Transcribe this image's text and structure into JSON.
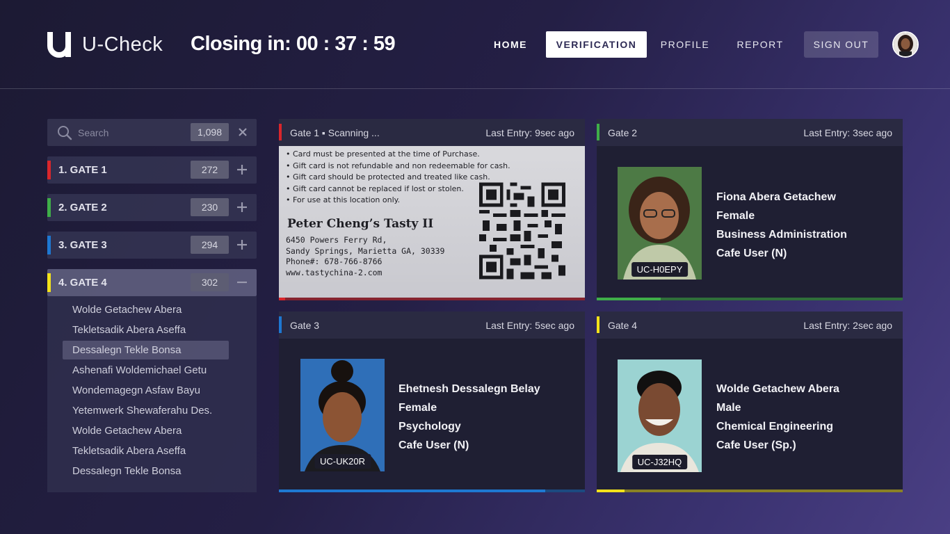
{
  "app": {
    "name": "U-Check",
    "closing": "Closing in: 00 : 37 : 59"
  },
  "nav": {
    "home": "HOME",
    "verification": "VERIFICATION",
    "profile": "PROFILE",
    "report": "REPORT",
    "signout": "SIGN OUT"
  },
  "search": {
    "placeholder": "Search",
    "count": "1,098"
  },
  "gates": [
    {
      "label": "1.  GATE 1",
      "count": "272",
      "color": "#d9262b",
      "toggle": "plus-icon"
    },
    {
      "label": "2.  GATE 2",
      "count": "230",
      "color": "#3fae49",
      "toggle": "plus-icon"
    },
    {
      "label": "3.  GATE 3",
      "count": "294",
      "color": "#1e78d2",
      "toggle": "plus-icon"
    },
    {
      "label": "4.  GATE 4",
      "count": "302",
      "color": "#f3e21a",
      "toggle": "minus-icon"
    }
  ],
  "gate4_people": [
    "Wolde Getachew Abera",
    "Tekletsadik Abera Aseffa",
    "Dessalegn Tekle Bonsa",
    "Ashenafi Woldemichael Getu",
    "Wondemagegn Asfaw Bayu",
    "Yetemwerk Shewaferahu Des.",
    "Wolde Getachew Abera",
    "Tekletsadik Abera Aseffa",
    "Dessalegn Tekle Bonsa"
  ],
  "panels": {
    "gate1": {
      "title": "Gate 1  ▪  Scanning ...",
      "last": "Last Entry: 9sec ago",
      "color": "#d9262b",
      "progress": 0.02,
      "card": {
        "terms": [
          "• Card must be presented at the time of Purchase.",
          "• Gift card is not refundable and non redeemable for cash.",
          "• Gift card should be protected and treated like cash.",
          "• Gift card cannot be replaced if lost or stolen.",
          "• For use at this location only."
        ],
        "shop": "Peter Cheng’s Tasty II",
        "address": [
          "6450 Powers Ferry Rd,",
          "Sandy Springs, Marietta GA, 30339",
          "Phone#: 678-766-8766",
          "www.tastychina-2.com"
        ]
      }
    },
    "gate2": {
      "title": "Gate 2",
      "last": "Last Entry:  3sec ago",
      "color": "#3fae49",
      "progress": 0.21,
      "id": "UC-H0EPY",
      "name": "Fiona Abera Getachew",
      "gender": "Female",
      "department": "Business Administration",
      "type": "Cafe User (N)"
    },
    "gate3": {
      "title": "Gate 3",
      "last": "Last Entry: 5sec ago",
      "color": "#1e78d2",
      "progress": 0.87,
      "id": "UC-UK20R",
      "name": "Ehetnesh Dessalegn Belay",
      "gender": "Female",
      "department": "Psychology",
      "type": "Cafe User (N)"
    },
    "gate4": {
      "title": "Gate 4",
      "last": "Last Entry: 2sec ago",
      "color": "#f3e21a",
      "progress": 0.09,
      "id": "UC-J32HQ",
      "name": "Wolde Getachew Abera",
      "gender": "Male",
      "department": "Chemical Engineering",
      "type": "Cafe User (Sp.)"
    }
  }
}
